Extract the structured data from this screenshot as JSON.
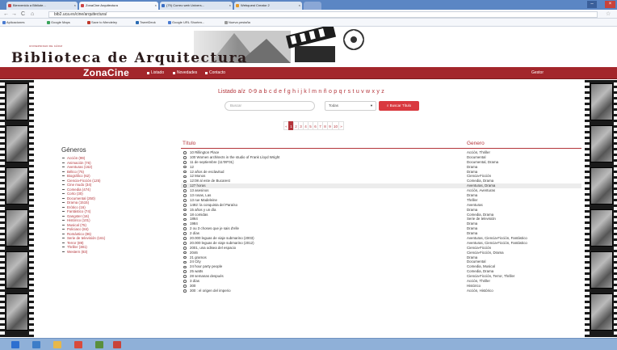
{
  "browser": {
    "tabs": [
      {
        "label": "Bienvenido a Bibliote..."
      },
      {
        "label": "ZonaCine Arquitectura"
      },
      {
        "label": "(79) Correo web Univers..."
      },
      {
        "label": "Webquest Creator 2"
      }
    ],
    "url": "bib2.uca.es/cine/arquitectura/",
    "bookmarks": [
      {
        "label": "Aplicaciones",
        "color": "#4a7bd0"
      },
      {
        "label": "Google Maps",
        "color": "#3aa35a"
      },
      {
        "label": "Save to Mendeley",
        "color": "#c0392b"
      },
      {
        "label": "TweetDeck",
        "color": "#2b6cb3"
      },
      {
        "label": "Google URL Shorten...",
        "color": "#4a7bd0"
      },
      {
        "label": "Nueva pestaña",
        "color": "#999999"
      }
    ]
  },
  "header": {
    "university": "UNIVERSIDAD DE CÁDIZ",
    "title": "Biblioteca de Arquitectura"
  },
  "nav": {
    "brand": "ZonaCine",
    "links": [
      "Listado",
      "Novedades",
      "Contacto"
    ],
    "gestor": "Gestor"
  },
  "alphabet": {
    "label": "Listado a/z",
    "letters": [
      "0-9",
      "a",
      "b",
      "c",
      "d",
      "e",
      "f",
      "g",
      "h",
      "i",
      "j",
      "k",
      "l",
      "m",
      "n",
      "ñ",
      "o",
      "p",
      "q",
      "r",
      "s",
      "t",
      "u",
      "v",
      "w",
      "x",
      "y",
      "z"
    ]
  },
  "search": {
    "placeholder": "Buscar",
    "select_value": "Todas",
    "button_label": "Buscar Título"
  },
  "pagination": [
    "«",
    "1",
    "2",
    "3",
    "4",
    "5",
    "6",
    "7",
    "8",
    "9",
    "10",
    "»"
  ],
  "genres": {
    "title": "Géneros",
    "items": [
      "Acción (99)",
      "Animación (76)",
      "Aventuras (162)",
      "Bélico (75)",
      "Biográfico (62)",
      "Ciencia-Ficción (125)",
      "Cine mudo (34)",
      "Comedia (474)",
      "Corto (30)",
      "Documental (250)",
      "Drama (1515)",
      "Erótico (16)",
      "Fantástico (74)",
      "Gangster (16)",
      "Histórico (101)",
      "Musical (75)",
      "Policiaco (84)",
      "Romántico (86)",
      "Serie de televisión (161)",
      "Terror (89)",
      "Thriller (381)",
      "Western (83)"
    ]
  },
  "table": {
    "col_title": "Título",
    "col_genre": "Genero",
    "rows": [
      {
        "title": "10 Rillington Place",
        "genre": "Acción, Thriller"
      },
      {
        "title": "100 Women architects in the studio of Frank Lloyd Wright",
        "genre": "Documental"
      },
      {
        "title": "11 de septiembre (11'09\"01)",
        "genre": "Documental, Drama"
      },
      {
        "title": "12",
        "genre": "Drama"
      },
      {
        "title": "12 años de esclavitud",
        "genre": "Drama"
      },
      {
        "title": "12 Monos",
        "genre": "Ciencia-Ficción"
      },
      {
        "title": "12:08 al este de Bucarest",
        "genre": "Comedia, Drama"
      },
      {
        "title": "127 horas",
        "genre": "Aventuras, Drama"
      },
      {
        "title": "13 asesinos",
        "genre": "Acción, Aventuras"
      },
      {
        "title": "13 rosas, Las",
        "genre": "Drama"
      },
      {
        "title": "13 rue Madeleine",
        "genre": "Thriller"
      },
      {
        "title": "1492: la conquista del Paraíso",
        "genre": "Aventuras"
      },
      {
        "title": "15 años y un día",
        "genre": "Drama"
      },
      {
        "title": "18 comidas",
        "genre": "Comedia, Drama"
      },
      {
        "title": "1864",
        "genre": "Serie de televisión"
      },
      {
        "title": "1984",
        "genre": "Drama"
      },
      {
        "title": "2 ou 3 choses que je sais d'elle",
        "genre": "Drama"
      },
      {
        "title": "2 días",
        "genre": "Drama"
      },
      {
        "title": "20.000 leguas de viaje submarino (2003)",
        "genre": "Aventuras, Ciencia-Ficción, Fantástico"
      },
      {
        "title": "20.000 leguas de viaje submarino (2012)",
        "genre": "Aventuras, Ciencia-Ficción, Fantástico"
      },
      {
        "title": "2001, una odisea del espacio",
        "genre": "Ciencia-Ficción"
      },
      {
        "title": "2046",
        "genre": "Ciencia-Ficción, Drama"
      },
      {
        "title": "21 gramos",
        "genre": "Drama"
      },
      {
        "title": "24 City",
        "genre": "Documental"
      },
      {
        "title": "24 hour party people",
        "genre": "Comedia, Musical"
      },
      {
        "title": "25 watts",
        "genre": "Comedia, Drama"
      },
      {
        "title": "28 semanas después",
        "genre": "Ciencia-Ficción, Terror, Thriller"
      },
      {
        "title": "3 días",
        "genre": "Acción, Thriller"
      },
      {
        "title": "300",
        "genre": "Histórico"
      },
      {
        "title": "300 : el origen del imperio",
        "genre": "Acción, Histórico"
      }
    ]
  },
  "colors": {
    "brand_red": "#a3262b",
    "link_red": "#b3343a",
    "button_red": "#d9393f"
  }
}
